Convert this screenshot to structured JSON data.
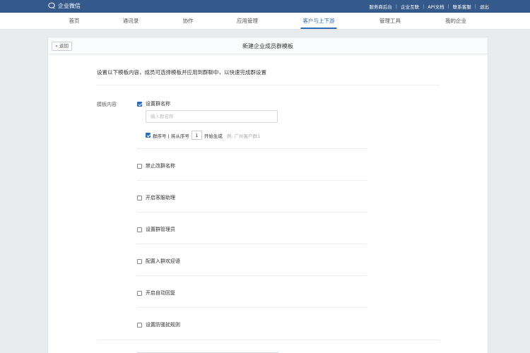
{
  "topbar": {
    "brand_name": "企业微信",
    "brand_icon": "chat-bubble-logo-icon",
    "links": [
      "服务商后台",
      "企业互联",
      "API文档",
      "联系客服",
      "退出"
    ]
  },
  "nav": {
    "items": [
      "首页",
      "通讯录",
      "协作",
      "应用管理",
      "客户与上下游",
      "管理工具",
      "我的企业"
    ],
    "active": "客户与上下游"
  },
  "page": {
    "back_label": "返回",
    "title": "新建企业成员群模板",
    "intro": "设置以下模板内容，成员可选择模板并应用到群聊中，以快速完成群设置"
  },
  "template": {
    "section_label": "模板内容",
    "group_name": {
      "label": "设置群名称",
      "checked": true,
      "input_placeholder": "输入群名称",
      "input_value": ""
    },
    "sequence": {
      "checked": true,
      "prefix": "群序号 | 将从序号",
      "start_value": "1",
      "suffix": "开始生成",
      "example": "例: 广州客户群1"
    },
    "options": [
      {
        "label": "禁止改群名称",
        "checked": false
      },
      {
        "label": "开启客服助理",
        "checked": false
      },
      {
        "label": "设置群管理员",
        "checked": false
      },
      {
        "label": "配置入群欢迎语",
        "checked": false
      },
      {
        "label": "开启自动回复",
        "checked": false
      },
      {
        "label": "设置防骚扰规则",
        "checked": false
      }
    ]
  },
  "colors": {
    "topbar_bg": "#34598a",
    "accent": "#2f6db5",
    "page_bg": "#e9ecef"
  }
}
